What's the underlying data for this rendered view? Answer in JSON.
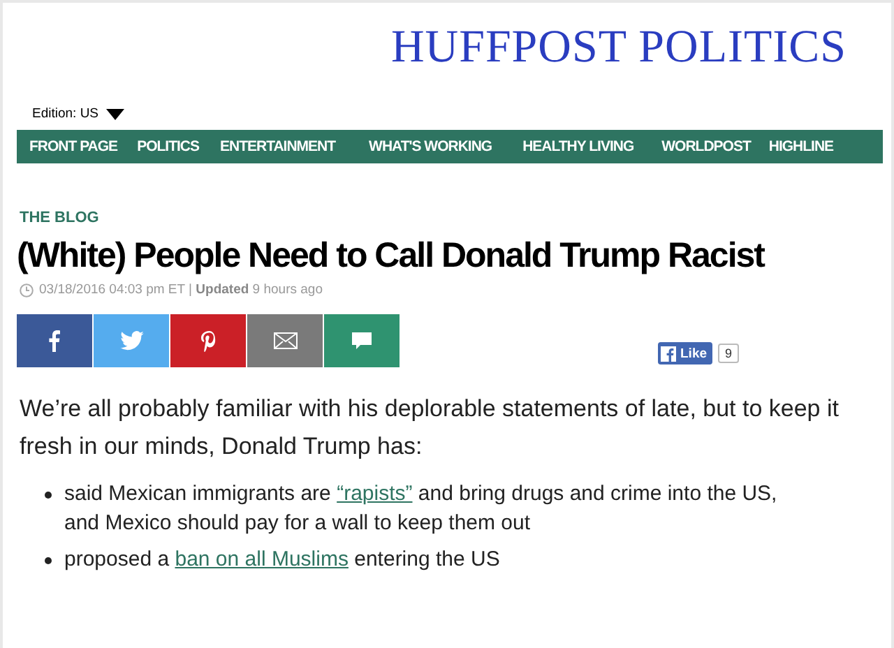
{
  "logo": "HUFFPOST POLITICS",
  "edition": {
    "label": "Edition: US"
  },
  "nav": [
    "FRONT PAGE",
    "POLITICS",
    "ENTERTAINMENT",
    "WHAT'S WORKING",
    "HEALTHY LIVING",
    "WORLDPOST",
    "HIGHLINE"
  ],
  "section": "THE BLOG",
  "headline": "(White) People Need to Call Donald Trump Racist",
  "meta": {
    "date": "03/18/2016 04:03 pm ET",
    "separator": "|",
    "updated_label": "Updated",
    "updated": "9 hours ago"
  },
  "share_buttons": [
    {
      "kind": "facebook",
      "color": "#3b5998"
    },
    {
      "kind": "twitter",
      "color": "#55acee"
    },
    {
      "kind": "pinterest",
      "color": "#cb2027"
    },
    {
      "kind": "email",
      "color": "#7a7a7a"
    },
    {
      "kind": "comment",
      "color": "#2f9370"
    }
  ],
  "like": {
    "label": "Like",
    "count": "9"
  },
  "intro": "We’re all probably familiar with his deplorable statements of late, but to keep it fresh in our minds, Donald Trump has:",
  "bullets": [
    {
      "parts": [
        {
          "kind": "text",
          "text": "said Mexican immigrants are "
        },
        {
          "kind": "link",
          "text": "“rapists”"
        },
        {
          "kind": "text",
          "text": " and bring drugs and crime into the US, and Mexico should pay for a wall to keep them out"
        }
      ]
    },
    {
      "parts": [
        {
          "kind": "text",
          "text": "proposed a "
        },
        {
          "kind": "link",
          "text": "ban on all Muslims"
        },
        {
          "kind": "text",
          "text": " entering the US"
        }
      ]
    }
  ]
}
